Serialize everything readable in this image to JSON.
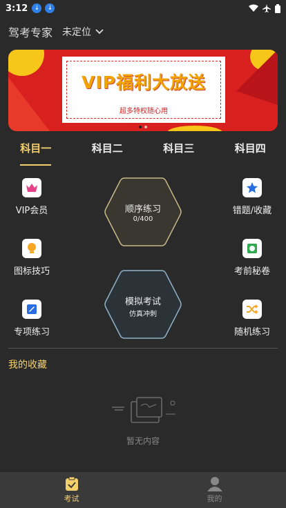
{
  "status": {
    "time": "3:12"
  },
  "header": {
    "brand": "驾考专家",
    "location": "未定位"
  },
  "banner": {
    "title": "VIP福利大放送",
    "subtitle": "超多特权随心用"
  },
  "tabs": [
    {
      "label": "科目一",
      "active": true
    },
    {
      "label": "科目二"
    },
    {
      "label": "科目三"
    },
    {
      "label": "科目四"
    }
  ],
  "grid": {
    "vip": "VIP会员",
    "mistakes": "错题/收藏",
    "icon_tips": "图标技巧",
    "secret": "考前秘卷",
    "special": "专项练习",
    "random": "随机练习"
  },
  "practice": {
    "label": "顺序练习",
    "progress": "0/400"
  },
  "mock": {
    "label": "模拟考试",
    "sub": "仿真冲刺"
  },
  "favorites": {
    "title": "我的收藏",
    "empty": "暂无内容"
  },
  "nav": {
    "exam": "考试",
    "mine": "我的"
  },
  "colors": {
    "accent": "#f4d06b",
    "banner_red": "#d8201f",
    "bg": "#2a2a2a"
  }
}
